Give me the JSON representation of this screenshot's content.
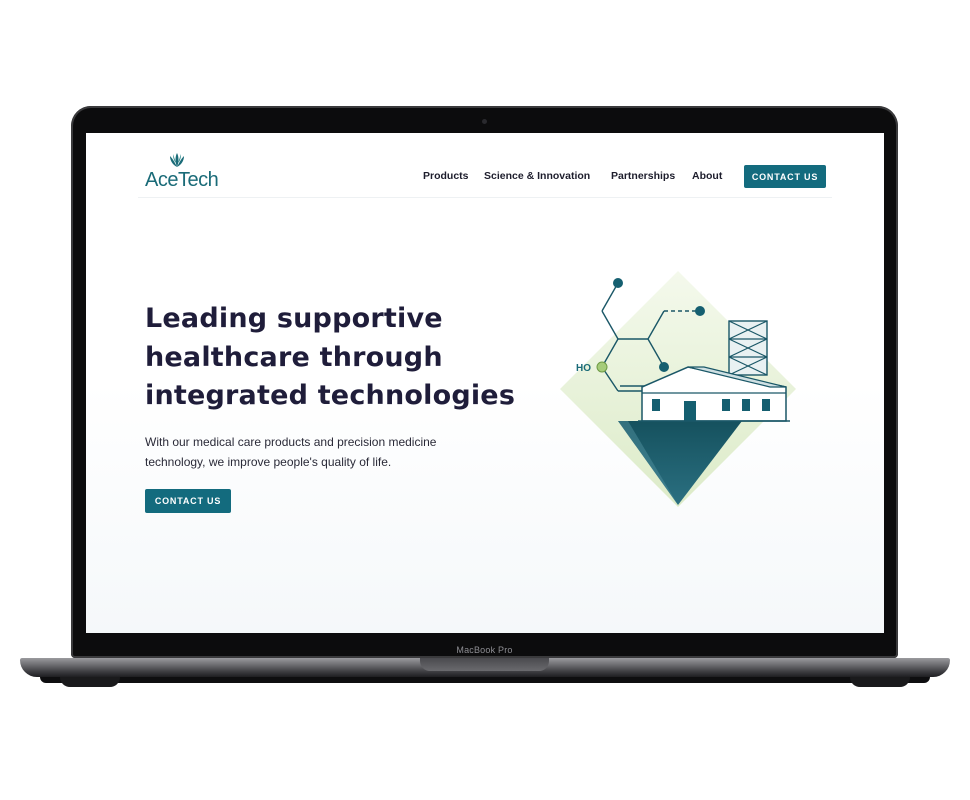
{
  "device": {
    "label": "MacBook Pro"
  },
  "site": {
    "logo": {
      "text": "AceTech",
      "icon": "flower-logo-icon",
      "color": "#1a6b78"
    },
    "nav": {
      "items": [
        "Products",
        "Science & Innovation",
        "Partnerships",
        "About"
      ],
      "cta": "CONTACT US"
    },
    "hero": {
      "title_lines": [
        "Leading supportive",
        "healthcare through",
        "integrated technologies"
      ],
      "subtitle_lines": [
        "With our medical care products and precision medicine",
        "technology, we improve people's quality of life."
      ],
      "cta": "CONTACT US",
      "illustration": {
        "label": "HO",
        "icon": "molecule-factory-illustration"
      }
    },
    "colors": {
      "accent": "#136b7e",
      "heading": "#1f1d3a",
      "illustration_green": "#e6f1d6"
    }
  }
}
